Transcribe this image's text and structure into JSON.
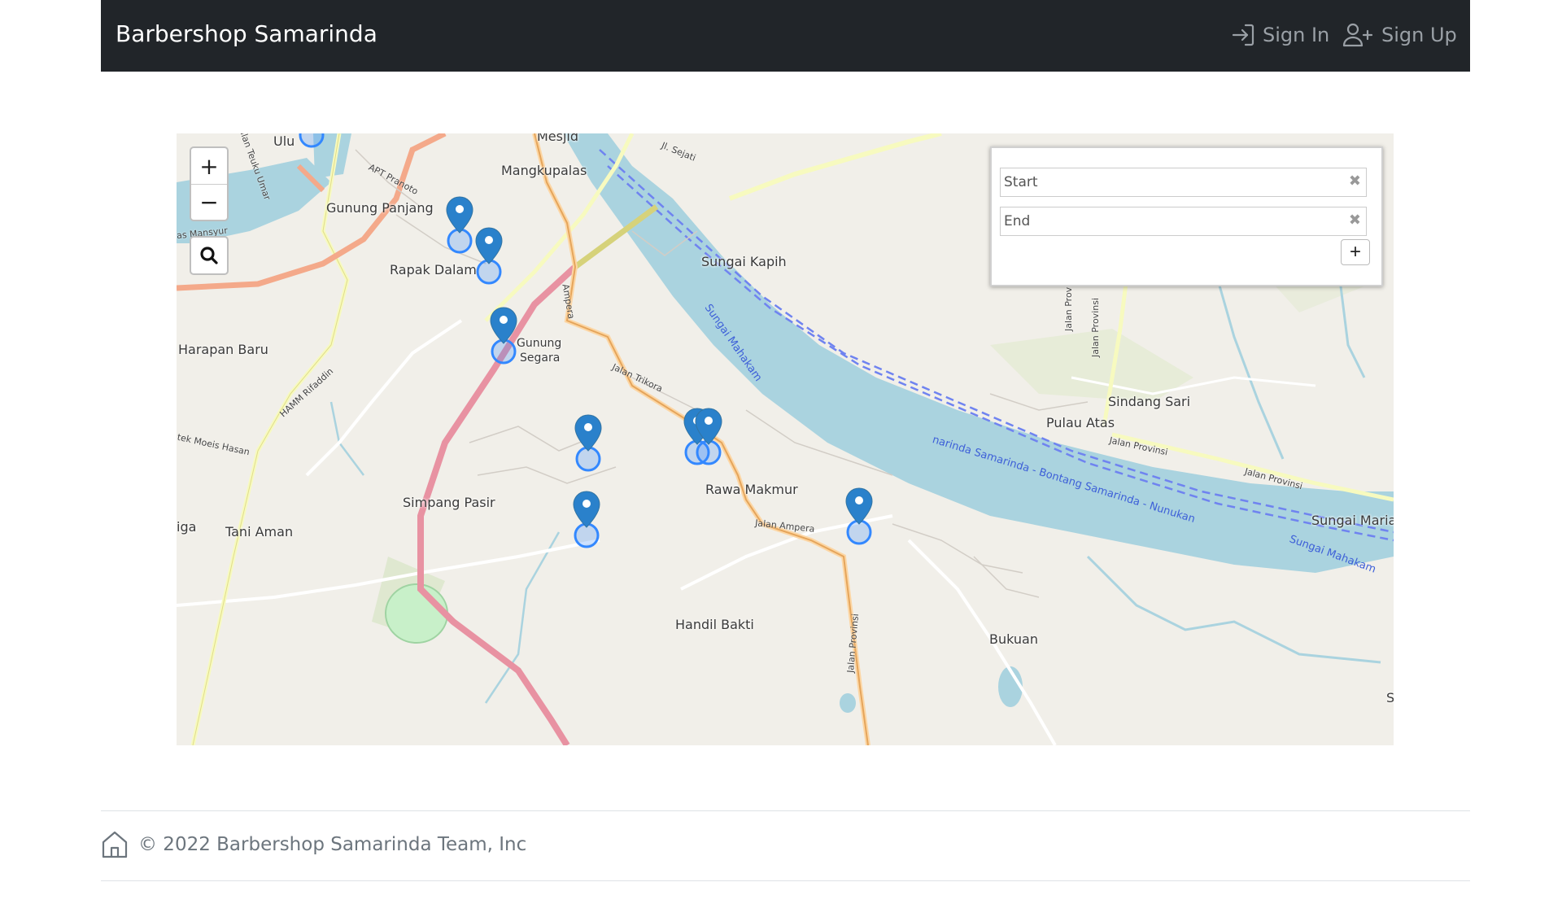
{
  "navbar": {
    "brand": "Barbershop Samarinda",
    "signin_label": "Sign In",
    "signup_label": "Sign Up"
  },
  "map": {
    "zoom_in": "+",
    "zoom_out": "−",
    "routing": {
      "start_placeholder": "Start",
      "end_placeholder": "End",
      "add_waypoint": "+"
    },
    "places": [
      "Ulu",
      "Mesjid",
      "Mangkupalas",
      "Gunung Panjang",
      "Rapak Dalam",
      "Sungai Kapih",
      "Harapan Baru",
      "Gunung",
      "Segara",
      "Sindang Sari",
      "Pulau Atas",
      "Rawa Makmur",
      "Simpang Pasir",
      "Tani Aman",
      "iga",
      "Handil Bakti",
      "Bukuan",
      "Sungai Maria",
      "S"
    ],
    "roads": [
      "Jl. Sejati",
      "APT Pranoto",
      "Jalan Teuku Umar",
      "as Mansyur",
      "Ampera",
      "Jalan Trikora",
      "HAMM Rifaddin",
      "tek Moeis Hasan",
      "Jalan Ampera",
      "Jalan Provinsi",
      "Jalan Provinsi",
      "Jalan Provinsi",
      "Jalan Provinsi",
      "Jalan Provinsi"
    ],
    "water": [
      "Sungai Mahakam",
      "narinda Samarinda - Bontang Samarinda - Nunukan",
      "Sungai Mahakam"
    ],
    "marker_count": 9
  },
  "footer": {
    "text": "© 2022 Barbershop Samarinda Team, Inc"
  }
}
